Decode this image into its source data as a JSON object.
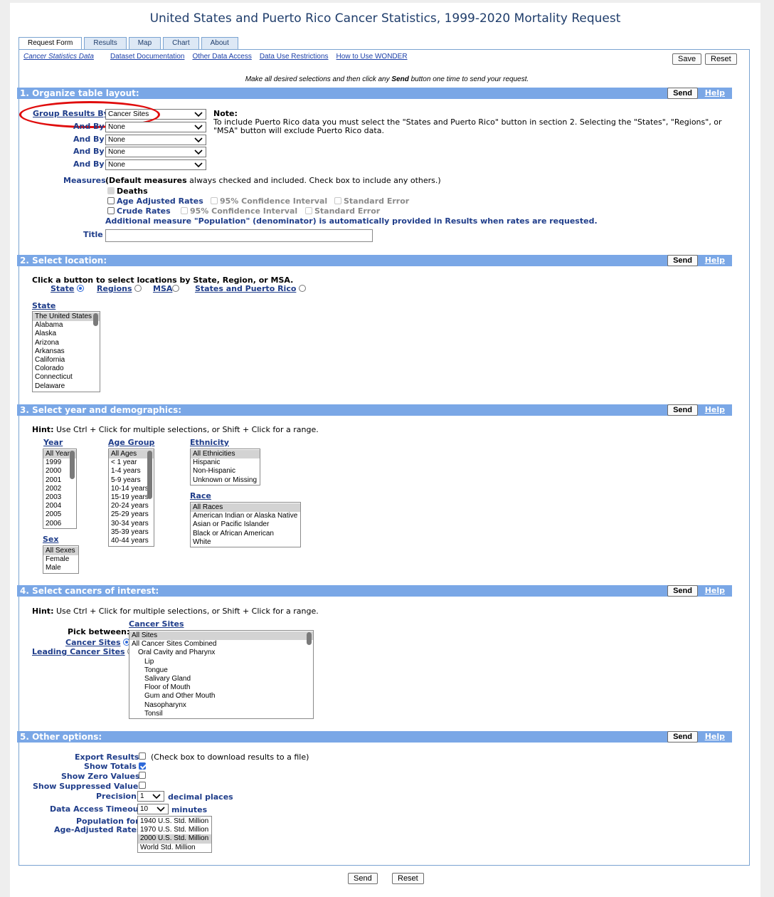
{
  "title": "United States and Puerto Rico Cancer Statistics, 1999-2020 Mortality Request",
  "tabs": [
    "Request Form",
    "Results",
    "Map",
    "Chart",
    "About"
  ],
  "topnav": [
    "Cancer Statistics Data",
    "Dataset Documentation",
    "Other Data Access",
    "Data Use Restrictions",
    "How to Use WONDER"
  ],
  "save_label": "Save",
  "reset_label": "Reset",
  "send_label": "Send",
  "help_label": "Help",
  "instruction_pre": "Make all desired selections and then click any ",
  "instruction_bold": "Send",
  "instruction_post": " button one time to send your request.",
  "section1": {
    "heading": "1. Organize table layout:",
    "group_results_by_label": "Group Results By",
    "group_results_by_value": "Cancer Sites",
    "and_by_label": "And By",
    "and_by_values": [
      "None",
      "None",
      "None",
      "None"
    ],
    "note_title": "Note:",
    "note_text": "To include Puerto Rico data you must select the \"States and Puerto Rico\" button in section 2. Selecting the \"States\", \"Regions\", or \"MSA\" button will exclude Puerto Rico data.",
    "measures_label": "Measures",
    "measures_intro_bold": "(Default measures",
    "measures_intro_rest": " always checked and included. Check box to include any others.)",
    "deaths": "Deaths",
    "age_adjusted_rates": "Age Adjusted Rates",
    "crude_rates": "Crude Rates",
    "ci_95": "95% Confidence Interval",
    "standard_error": "Standard Error",
    "population_note": "Additional measure \"Population\" (denominator) is automatically provided in Results when rates are requested.",
    "title_label": "Title",
    "title_value": ""
  },
  "section2": {
    "heading": "2. Select location:",
    "instruction": "Click a button to select locations by State, Region, or MSA.",
    "options": [
      "State",
      "Regions",
      "MSA",
      "States and Puerto Rico"
    ],
    "selected_option": "State",
    "state_label": "State",
    "states": [
      "The United States",
      "Alabama",
      "Alaska",
      "Arizona",
      "Arkansas",
      "California",
      "Colorado",
      "Connecticut",
      "Delaware"
    ]
  },
  "section3": {
    "heading": "3. Select year and demographics:",
    "hint_bold": "Hint:",
    "hint_text": " Use Ctrl + Click for multiple selections, or Shift + Click for a range.",
    "year_label": "Year",
    "years": [
      "All Years",
      "1999",
      "2000",
      "2001",
      "2002",
      "2003",
      "2004",
      "2005",
      "2006"
    ],
    "age_group_label": "Age Group",
    "age_groups": [
      "All Ages",
      "< 1 year",
      "1-4 years",
      "5-9 years",
      "10-14 years",
      "15-19 years",
      "20-24 years",
      "25-29 years",
      "30-34 years",
      "35-39 years",
      "40-44 years"
    ],
    "ethnicity_label": "Ethnicity",
    "ethnicities": [
      "All Ethnicities",
      "Hispanic",
      "Non-Hispanic",
      "Unknown or Missing"
    ],
    "race_label": "Race",
    "races": [
      "All Races",
      "American Indian or Alaska Native",
      "Asian or Pacific Islander",
      "Black or African American",
      "White"
    ],
    "sex_label": "Sex",
    "sexes": [
      "All Sexes",
      "Female",
      "Male"
    ]
  },
  "section4": {
    "heading": "4. Select cancers of interest:",
    "hint_bold": "Hint:",
    "hint_text": " Use Ctrl + Click for multiple selections, or Shift + Click for a range.",
    "cancer_sites_header": "Cancer Sites",
    "pick_between": "Pick between:",
    "pick_options": [
      "Cancer Sites",
      "Leading Cancer Sites"
    ],
    "sites": [
      "All Sites",
      "All Cancer Sites Combined",
      "Oral Cavity and Pharynx",
      "Lip",
      "Tongue",
      "Salivary Gland",
      "Floor of Mouth",
      "Gum and Other Mouth",
      "Nasopharynx",
      "Tonsil"
    ]
  },
  "section5": {
    "heading": "5. Other options:",
    "export_results": "Export Results",
    "export_note": "(Check box to download results to a file)",
    "show_totals": "Show Totals",
    "show_zero_values": "Show Zero Values",
    "show_suppressed_values": "Show Suppressed Values",
    "precision_label": "Precision",
    "precision_value": "1",
    "precision_unit": "decimal places",
    "timeout_label": "Data Access Timeout",
    "timeout_value": "10",
    "timeout_unit": "minutes",
    "population_label_1": "Population for",
    "population_label_2": "Age-Adjusted Rates",
    "populations": [
      "1940 U.S. Std. Million",
      "1970 U.S. Std. Million",
      "2000 U.S. Std. Million",
      "World Std. Million"
    ]
  }
}
